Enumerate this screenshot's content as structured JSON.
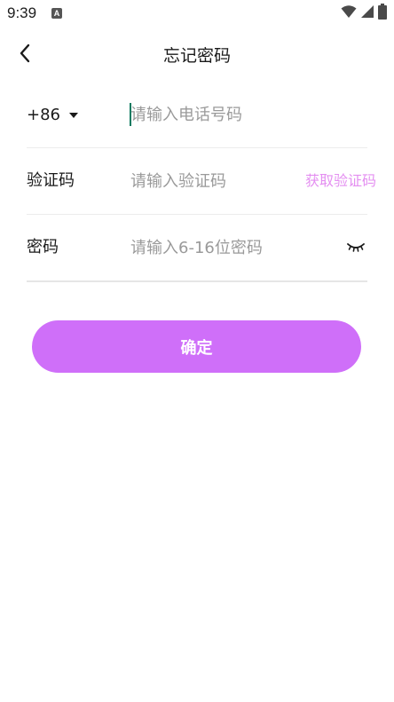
{
  "status_bar": {
    "time": "9:39",
    "notification_icon": "a-icon",
    "icons": [
      "wifi-icon",
      "signal-icon",
      "battery-icon"
    ]
  },
  "header": {
    "title": "忘记密码",
    "back_icon": "chevron-left-icon"
  },
  "form": {
    "phone": {
      "country_code": "+86",
      "placeholder": "请输入电话号码",
      "value": ""
    },
    "code": {
      "label": "验证码",
      "placeholder": "请输入验证码",
      "value": "",
      "get_code_label": "获取验证码"
    },
    "password": {
      "label": "密码",
      "placeholder": "请输入6-16位密码",
      "value": "",
      "toggle_icon": "eye-closed-icon"
    }
  },
  "confirm_button": {
    "label": "确定"
  },
  "colors": {
    "accent": "#cf6ff9",
    "link": "#e48ff1",
    "cursor": "#0b7a60",
    "placeholder": "#9a9a9a"
  }
}
